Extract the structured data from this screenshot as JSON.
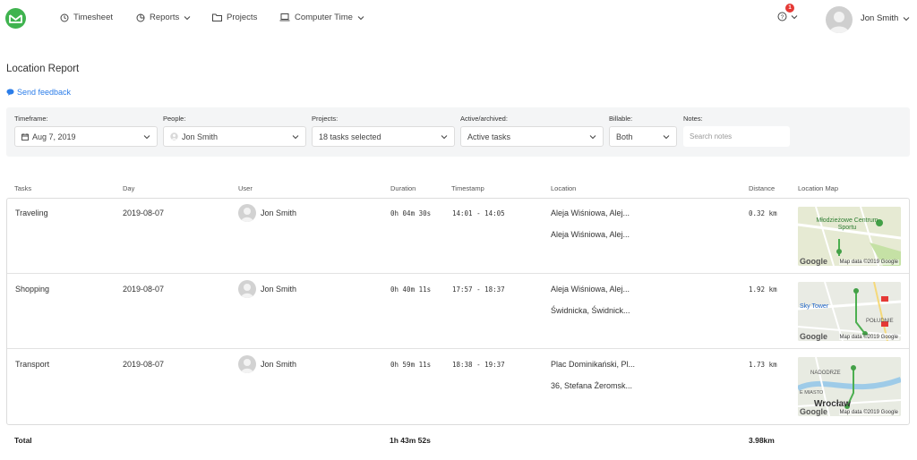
{
  "nav": {
    "items": [
      {
        "label": "Timesheet",
        "icon": "clock-icon"
      },
      {
        "label": "Reports",
        "icon": "chart-icon"
      },
      {
        "label": "Projects",
        "icon": "folder-icon"
      },
      {
        "label": "Computer Time",
        "icon": "laptop-icon"
      }
    ],
    "help_badge": "1",
    "user_name": "Jon Smith"
  },
  "page": {
    "title": "Location Report",
    "feedback": "Send feedback"
  },
  "filters": {
    "timeframe": {
      "label": "Timeframe:",
      "value": "Aug 7, 2019"
    },
    "people": {
      "label": "People:",
      "value": "Jon Smith"
    },
    "projects": {
      "label": "Projects:",
      "value": "18 tasks selected"
    },
    "active": {
      "label": "Active/archived:",
      "value": "Active tasks"
    },
    "billable": {
      "label": "Billable:",
      "value": "Both"
    },
    "notes": {
      "label": "Notes:",
      "placeholder": "Search notes"
    }
  },
  "table": {
    "headers": [
      "Tasks",
      "Day",
      "User",
      "Duration",
      "Timestamp",
      "Location",
      "Distance",
      "Location Map"
    ],
    "rows": [
      {
        "task": "Traveling",
        "day": "2019-08-07",
        "user": "Jon Smith",
        "duration": "0h 04m 30s",
        "timestamp": "14:01 - 14:05",
        "loc1": "Aleja Wiśniowa, Alej...",
        "loc2": "Aleja Wiśniowa, Alej...",
        "distance": "0.32 km",
        "map_label": "Młodzieżowe Centrum Sportu",
        "map_credit": "Map data ©2019 Google"
      },
      {
        "task": "Shopping",
        "day": "2019-08-07",
        "user": "Jon Smith",
        "duration": "0h 40m 11s",
        "timestamp": "17:57 - 18:37",
        "loc1": "Aleja Wiśniowa, Alej...",
        "loc2": "Świdnicka, Świdnick...",
        "distance": "1.92 km",
        "map_label": "Sky Tower",
        "map_label2": "POŁUDNIE",
        "map_credit": "Map data ©2019 Google"
      },
      {
        "task": "Transport",
        "day": "2019-08-07",
        "user": "Jon Smith",
        "duration": "0h 59m 11s",
        "timestamp": "18:38 - 19:37",
        "loc1": "Plac Dominikański, Pl...",
        "loc2": "36, Stefana Żeromsk...",
        "distance": "1.73 km",
        "map_label": "NADODRZE",
        "map_label2": "E MIASTO",
        "map_label3": "Wrocław",
        "map_credit": "Map data ©2019 Google"
      }
    ]
  },
  "totals": {
    "label": "Total",
    "duration": "1h 43m 52s",
    "distance": "3.98km"
  },
  "map_brand": "Google",
  "colors": {
    "accent": "#3fb34f",
    "link": "#2b7de9",
    "badge": "#e53935"
  }
}
